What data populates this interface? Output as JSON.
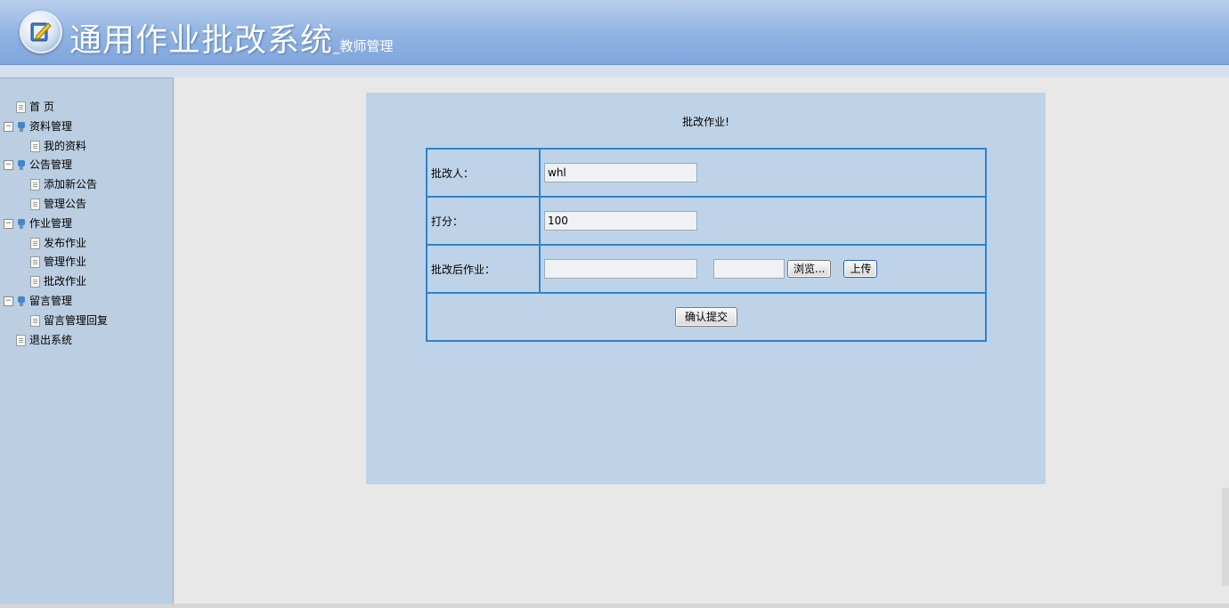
{
  "header": {
    "title": "通用作业批改系统",
    "subtitle": "_教师管理",
    "logo_icon": "pencil-check-icon"
  },
  "sidebar": {
    "items": [
      {
        "label": "首 页",
        "type": "leaf",
        "level": 0
      },
      {
        "label": "资料管理",
        "type": "group",
        "toggle": "⊟"
      },
      {
        "label": "我的资料",
        "type": "leaf",
        "level": 1
      },
      {
        "label": "公告管理",
        "type": "group",
        "toggle": "⊟"
      },
      {
        "label": "添加新公告",
        "type": "leaf",
        "level": 1
      },
      {
        "label": "管理公告",
        "type": "leaf",
        "level": 1
      },
      {
        "label": "作业管理",
        "type": "group",
        "toggle": "⊟"
      },
      {
        "label": "发布作业",
        "type": "leaf",
        "level": 1
      },
      {
        "label": "管理作业",
        "type": "leaf",
        "level": 1
      },
      {
        "label": "批改作业",
        "type": "leaf",
        "level": 1
      },
      {
        "label": "留言管理",
        "type": "group",
        "toggle": "⊟"
      },
      {
        "label": "留言管理回复",
        "type": "leaf",
        "level": 1
      },
      {
        "label": "退出系统",
        "type": "leaf",
        "level": 0
      }
    ]
  },
  "form": {
    "title": "批改作业!",
    "grader_label": "批改人：",
    "grader_value": "whl",
    "score_label": "打分：",
    "score_value": "100",
    "file_label": "批改后作业：",
    "file_value": "",
    "browse_path": "",
    "browse_button": "浏览...",
    "upload_button": "上传",
    "submit_button": "确认提交"
  },
  "colors": {
    "header": "#8fb2e2",
    "sidebar": "#bccee2",
    "panel": "#bfd3e8",
    "table_border": "#2f82c9"
  }
}
